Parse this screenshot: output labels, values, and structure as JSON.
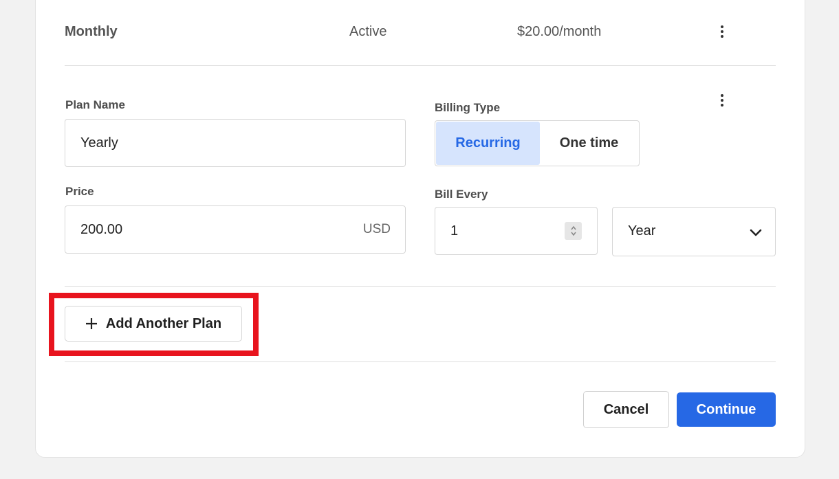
{
  "existing_plan": {
    "name": "Monthly",
    "status": "Active",
    "price": "$20.00/month"
  },
  "plan_form": {
    "plan_name_label": "Plan Name",
    "plan_name_value": "Yearly",
    "billing_type_label": "Billing Type",
    "billing_options": [
      "Recurring",
      "One time"
    ],
    "billing_selected": "Recurring",
    "price_label": "Price",
    "price_value": "200.00",
    "currency": "USD",
    "bill_every_label": "Bill Every",
    "bill_every_value": "1",
    "interval_value": "Year"
  },
  "actions": {
    "add_plan_label": "Add Another Plan",
    "cancel_label": "Cancel",
    "continue_label": "Continue"
  },
  "colors": {
    "accent": "#2668e5",
    "accent_light": "#d6e4fd",
    "highlight": "#e8141e"
  },
  "icons": [
    "more-vertical-icon",
    "plus-icon",
    "chevron-down-icon",
    "stepper-arrows-icon"
  ]
}
